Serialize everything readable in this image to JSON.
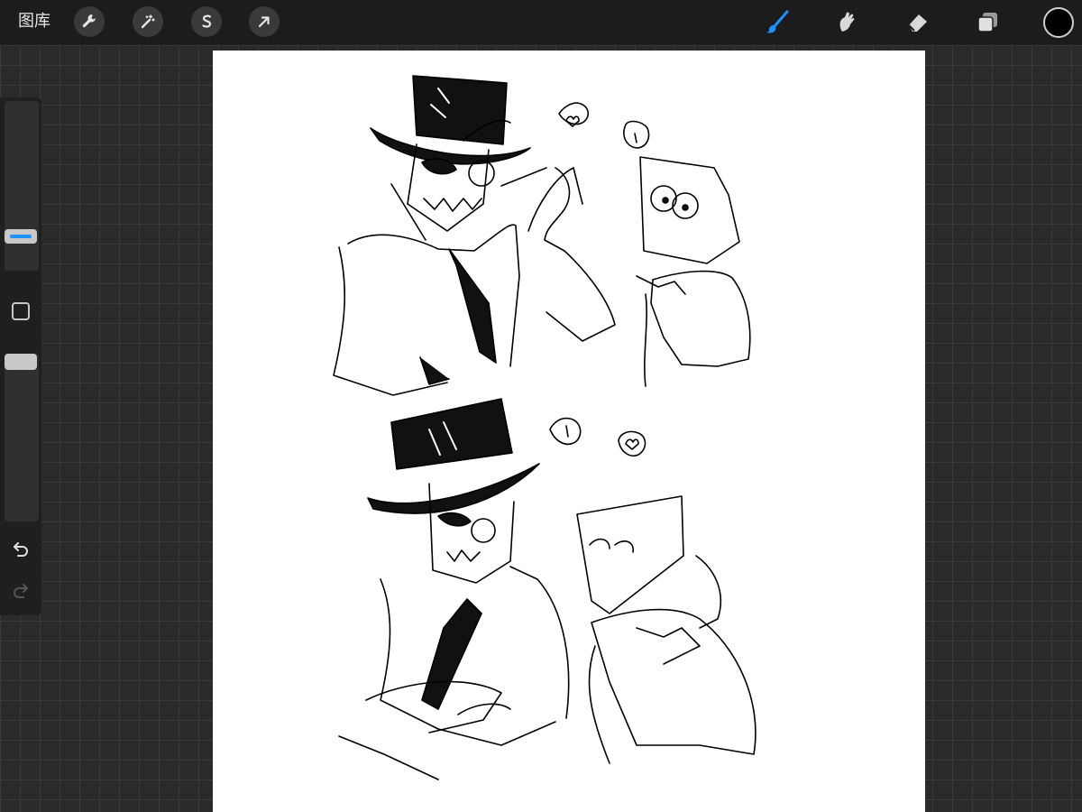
{
  "app": {
    "gallery_label": "图库"
  },
  "toolbar_left": [
    {
      "name": "actions",
      "icon": "wrench-icon"
    },
    {
      "name": "adjustments",
      "icon": "magic-wand-icon"
    },
    {
      "name": "selection",
      "icon": "selection-s-icon"
    },
    {
      "name": "transform",
      "icon": "arrow-cursor-icon"
    }
  ],
  "toolbar_right": [
    {
      "name": "brush",
      "icon": "brush-icon",
      "active": true
    },
    {
      "name": "smudge",
      "icon": "smudge-icon"
    },
    {
      "name": "eraser",
      "icon": "eraser-icon"
    },
    {
      "name": "layers",
      "icon": "layers-icon"
    }
  ],
  "current_color": "#000000",
  "accent_color": "#1e90ff",
  "sidebar": {
    "brush_size_slider": "slider",
    "opacity_slider": "slider",
    "modify_button": "square-icon",
    "undo": "undo-icon",
    "redo": "redo-icon"
  }
}
